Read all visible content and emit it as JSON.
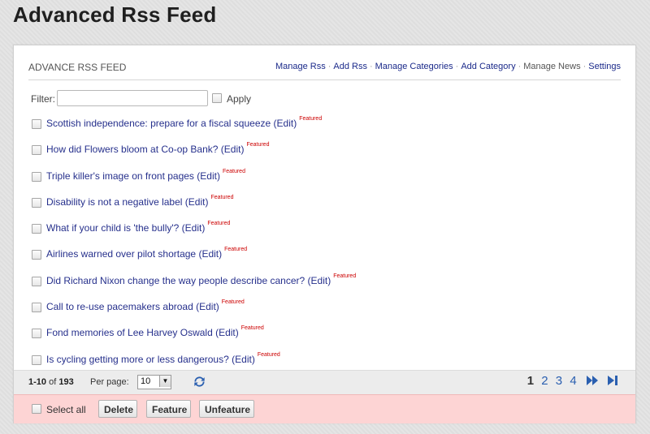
{
  "page": {
    "title": "Advanced Rss Feed"
  },
  "panel": {
    "title": "ADVANCE RSS FEED",
    "nav": [
      {
        "label": "Manage Rss",
        "active": true
      },
      {
        "label": "Add Rss",
        "active": true
      },
      {
        "label": "Manage Categories",
        "active": true
      },
      {
        "label": "Add Category",
        "active": true
      },
      {
        "label": "Manage News",
        "active": false
      },
      {
        "label": "Settings",
        "active": true
      }
    ],
    "nav_separator": "·"
  },
  "filter": {
    "label": "Filter:",
    "value": "",
    "apply_label": "Apply"
  },
  "items": [
    {
      "title": "Scottish independence: prepare for a fiscal squeeze",
      "edit": "(Edit)",
      "badge": "Featured"
    },
    {
      "title": "How did Flowers bloom at Co-op Bank?",
      "edit": "(Edit)",
      "badge": "Featured"
    },
    {
      "title": "Triple killer's image on front pages",
      "edit": "(Edit)",
      "badge": "Featured"
    },
    {
      "title": "Disability is not a negative label",
      "edit": "(Edit)",
      "badge": "Featured"
    },
    {
      "title": "What if your child is 'the bully'?",
      "edit": "(Edit)",
      "badge": "Featured"
    },
    {
      "title": "Airlines warned over pilot shortage",
      "edit": "(Edit)",
      "badge": "Featured"
    },
    {
      "title": "Did Richard Nixon change the way people describe cancer?",
      "edit": "(Edit)",
      "badge": "Featured"
    },
    {
      "title": "Call to re-use pacemakers abroad",
      "edit": "(Edit)",
      "badge": "Featured"
    },
    {
      "title": "Fond memories of Lee Harvey Oswald",
      "edit": "(Edit)",
      "badge": "Featured"
    },
    {
      "title": "Is cycling getting more or less dangerous?",
      "edit": "(Edit)",
      "badge": "Featured"
    }
  ],
  "pager": {
    "range": "1-10",
    "of_label": "of",
    "total": "193",
    "per_page_label": "Per page:",
    "per_page_value": "10",
    "pages": [
      "1",
      "2",
      "3",
      "4"
    ],
    "current_page": "1"
  },
  "actions": {
    "select_all_label": "Select all",
    "delete_label": "Delete",
    "feature_label": "Feature",
    "unfeature_label": "Unfeature"
  },
  "colors": {
    "link": "#26308c",
    "badge": "#cc0000",
    "action_bar": "#fdd4d4",
    "pager_link": "#2a5fb0"
  },
  "icons": {
    "refresh": "refresh-icon",
    "next": "fast-forward-icon",
    "last": "last-page-icon"
  }
}
